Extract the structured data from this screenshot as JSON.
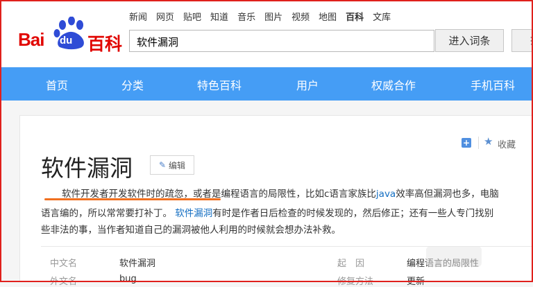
{
  "logo": {
    "bai": "Bai",
    "du": "du",
    "baike": "百科"
  },
  "topnav": [
    "新闻",
    "网页",
    "贴吧",
    "知道",
    "音乐",
    "图片",
    "视频",
    "地图",
    "百科",
    "文库"
  ],
  "topnav_active": "百科",
  "search": {
    "value": "软件漏洞"
  },
  "buttons": {
    "enter": "进入词条",
    "search": "搜索"
  },
  "mainnav": [
    "首页",
    "分类",
    "特色百科",
    "用户",
    "权威合作",
    "手机百科"
  ],
  "actions": {
    "plus": "+",
    "collect": "收藏"
  },
  "entry": {
    "title": "软件漏洞",
    "edit": "编辑",
    "line1": "软件开发者开发软件时的疏忽，或者是编程语言的局限性，比如c语言家族比",
    "line1_link": "java",
    "line1_tail": "效率高但漏洞也多，电脑",
    "line2_head": "语言编的，所以常常要打补丁。",
    "line2_link": "软件漏洞",
    "line2_tail": "有时是作者日后检查的时候发现的，然后修正；还有一些人专门找别",
    "line3": "些非法的事，当作者知道自己的漏洞被他人利用的时候就会想办法补救。"
  },
  "info": [
    {
      "label": "中文名",
      "value": "软件漏洞"
    },
    {
      "label": "起　因",
      "value": "编程语言的局限性"
    },
    {
      "label": "外文名",
      "value": "bug"
    },
    {
      "label": "修复方法",
      "value": "更新"
    }
  ],
  "colors": {
    "brand_red": "#e10602",
    "nav_blue": "#459df5",
    "link": "#136ec2",
    "underline": "#f07020"
  }
}
